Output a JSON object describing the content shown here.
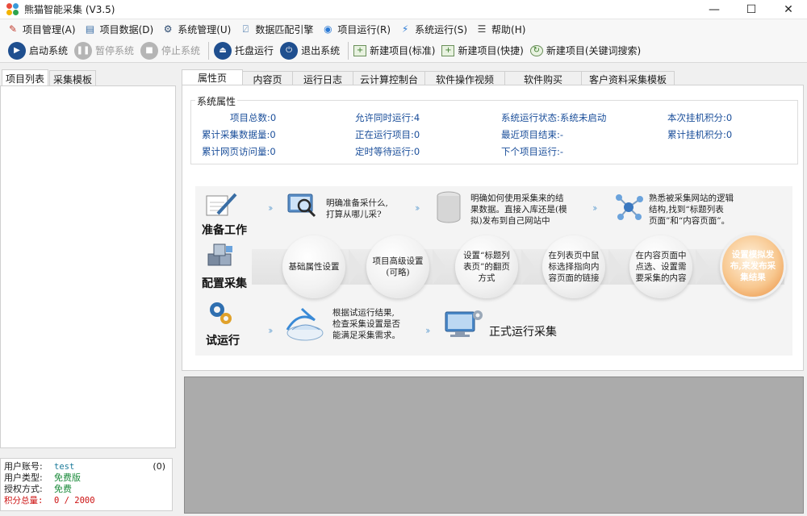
{
  "window": {
    "title": "熊猫智能采集 (V3.5)",
    "controls": {
      "minimize": "—",
      "maximize": "☐",
      "close": "✕"
    }
  },
  "menu": [
    {
      "label": "项目管理(A)",
      "icon": "project-manage-icon"
    },
    {
      "label": "项目数据(D)",
      "icon": "project-data-icon"
    },
    {
      "label": "系统管理(U)",
      "icon": "system-manage-icon"
    },
    {
      "label": "数据匹配引擎",
      "icon": "data-match-icon"
    },
    {
      "label": "项目运行(R)",
      "icon": "project-run-icon"
    },
    {
      "label": "系统运行(S)",
      "icon": "system-run-icon"
    },
    {
      "label": "帮助(H)",
      "icon": "help-icon"
    }
  ],
  "toolbar": {
    "start": "启动系统",
    "pause": "暂停系统",
    "stop": "停止系统",
    "tray": "托盘运行",
    "exit": "退出系统",
    "new_standard": "新建项目(标准)",
    "new_quick": "新建项目(快捷)",
    "new_keyword": "新建项目(关键词搜索)"
  },
  "left_tabs": [
    "项目列表",
    "采集模板"
  ],
  "user": {
    "account_label": "用户账号:",
    "account_value": "test",
    "count": "(0)",
    "type_label": "用户类型:",
    "type_value": "免费版",
    "auth_label": "授权方式:",
    "auth_value": "免费",
    "points_label": "积分总量:",
    "points_value": "0 / 2000"
  },
  "main_tabs": [
    "属性页",
    "内容页",
    "运行日志",
    "云计算控制台",
    "软件操作视频",
    "软件购买",
    "客户资料采集模板"
  ],
  "system_props": {
    "title": "系统属性",
    "items": [
      {
        "label": "项目总数:",
        "value": "0"
      },
      {
        "label": "允许同时运行:",
        "value": "4"
      },
      {
        "label": "系统运行状态:",
        "value": "系统未启动"
      },
      {
        "label": "本次挂机积分:",
        "value": "0"
      },
      {
        "label": "累计采集数据量:",
        "value": "0"
      },
      {
        "label": "正在运行项目:",
        "value": "0"
      },
      {
        "label": "最近项目结束:",
        "value": "-"
      },
      {
        "label": "累计挂机积分:",
        "value": "0"
      },
      {
        "label": "累计网页访问量:",
        "value": "0"
      },
      {
        "label": "定时等待运行:",
        "value": "0"
      },
      {
        "label": "下个项目运行:",
        "value": "-"
      }
    ]
  },
  "flow": {
    "stage1": "准备工作",
    "stage2": "配置采集",
    "stage3": "试运行",
    "step1_a": "明确准备采什么,",
    "step1_b": "打算从哪儿采?",
    "step2_a": "明确如何使用采集来的结",
    "step2_b": "果数据。直接入库还是(模",
    "step2_c": "拟)发布到自己网站中",
    "step3_a": "熟悉被采集网站的逻辑",
    "step3_b": "结构,找到“标题列表",
    "step3_c": "页面”和“内容页面”。",
    "c1": "基础属性设置",
    "c2": "项目高级设置(可略)",
    "c3": "设置“标题列表页”的翻页方式",
    "c4": "在列表页中鼠标选择指向内容页面的链接",
    "c5": "在内容页面中点选、设置需要采集的内容",
    "c6": "设置模拟发布,来发布采集结果",
    "trial_a": "根据试运行结果,",
    "trial_b": "检查采集设置是否",
    "trial_c": "能满足采集需求。",
    "formal": "正式运行采集"
  }
}
